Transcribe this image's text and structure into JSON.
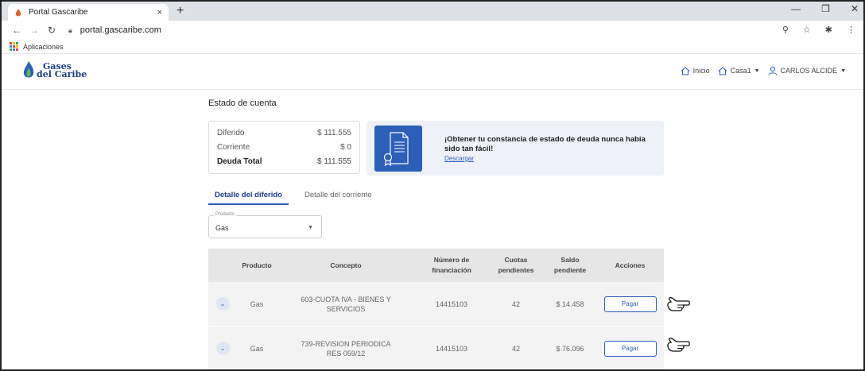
{
  "browser": {
    "tab_title": "Portal Gascaribe",
    "tab_close": "×",
    "new_tab": "+",
    "url": "portal.gascaribe.com",
    "bookmarks_label": "Aplicaciones",
    "window_controls": [
      "—",
      "❐",
      "✕"
    ]
  },
  "site": {
    "logo_line1": "Gases",
    "logo_line2": "del Caribe",
    "nav_home": "Inicio",
    "nav_house": "Casa1",
    "nav_user": "CARLOS ALCIDE"
  },
  "account": {
    "title": "Estado de cuenta",
    "rows": [
      {
        "label": "Diferido",
        "value": "$ 111.555"
      },
      {
        "label": "Corriente",
        "value": "$ 0"
      },
      {
        "label": "Deuda Total",
        "value": "$ 111.555"
      }
    ]
  },
  "promo": {
    "heading": "¡Obtener tu constancia de estado de deuda nunca había sido tan fácil!",
    "link": "Descargar"
  },
  "tabs": [
    {
      "label": "Detalle del diferido",
      "active": true
    },
    {
      "label": "Detalle del corriente",
      "active": false
    }
  ],
  "product_select": {
    "legend": "Producto",
    "value": "Gas"
  },
  "table": {
    "headers": [
      [
        "",
        ""
      ],
      [
        "Producto",
        ""
      ],
      [
        "Concepto",
        ""
      ],
      [
        "Número de",
        "financiación"
      ],
      [
        "Cuotas",
        "pendientes"
      ],
      [
        "Saldo",
        "pendiente"
      ],
      [
        "Acciones",
        ""
      ]
    ],
    "rows": [
      {
        "producto": "Gas",
        "concepto_1": "603-CUOTA IVA - BIENES Y",
        "concepto_2": "SERVICIOS",
        "numero": "14415103",
        "cuotas": "42",
        "saldo": "$ 14.458",
        "accion": "Pagar"
      },
      {
        "producto": "Gas",
        "concepto_1": "739-REVISION PERIODICA",
        "concepto_2": "RES 059/12",
        "numero": "14415103",
        "cuotas": "42",
        "saldo": "$ 76.096",
        "accion": "Pagar"
      }
    ]
  },
  "colors": {
    "brand_blue": "#2b5fb8",
    "brand_navy": "#1b3e8f",
    "table_header": "#e6e6e6",
    "row_bg": "#f3f3f3"
  },
  "icons": [
    "favicon-flame-icon",
    "back-icon",
    "forward-icon",
    "reload-icon",
    "lock-icon",
    "zoom-icon",
    "star-icon",
    "extensions-icon",
    "menu-icon",
    "apps-grid-icon",
    "home-icon",
    "user-icon",
    "document-certificate-icon",
    "chevron-down-icon",
    "pointing-hand-icon"
  ]
}
